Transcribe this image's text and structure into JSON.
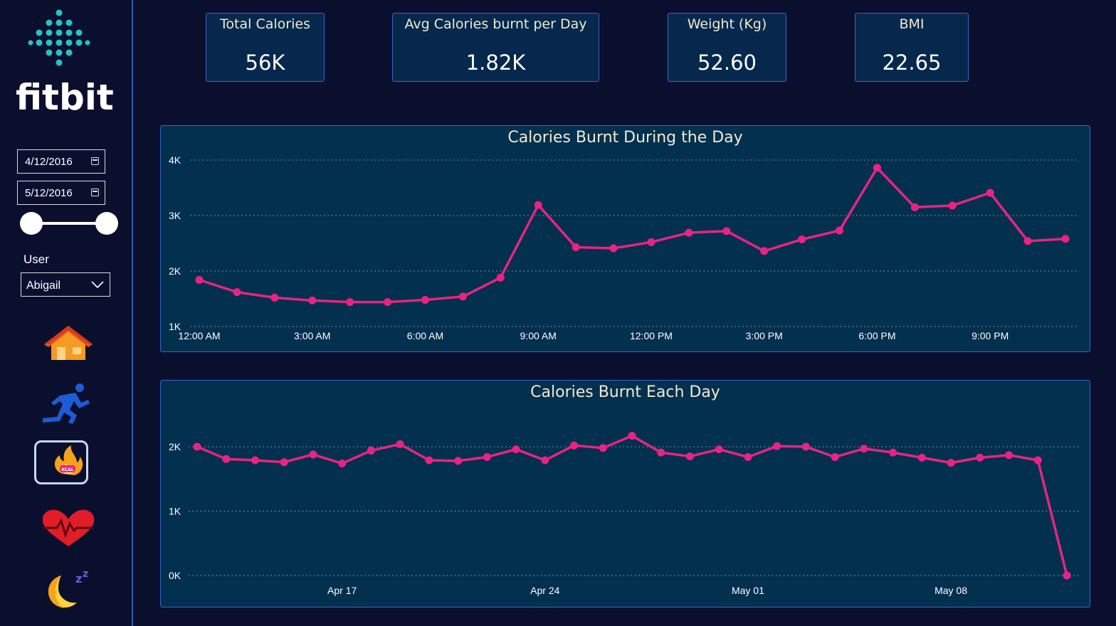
{
  "sidebar": {
    "brand": "fitbit",
    "date_start": "4/12/2016",
    "date_end": "5/12/2016",
    "user_label": "User",
    "user_value": "Abigail",
    "nav_items": [
      "home-icon",
      "running-icon",
      "calories-icon",
      "heart-rate-icon",
      "sleep-icon"
    ],
    "calories_badge": "KCAL"
  },
  "kpis": [
    {
      "title": "Total Calories",
      "value": "56K"
    },
    {
      "title": "Avg Calories burnt per Day",
      "value": "1.82K"
    },
    {
      "title": "Weight (Kg)",
      "value": "52.60"
    },
    {
      "title": "BMI",
      "value": "22.65"
    }
  ],
  "colors": {
    "background": "#0b0f2e",
    "panel": "#03304f",
    "border": "#3a63c8",
    "series": "#e8247f",
    "title_text": "#f0ead0"
  },
  "chart_data": [
    {
      "type": "line",
      "title": "Calories Burnt During the Day",
      "x": [
        "12:00 AM",
        "1:00 AM",
        "2:00 AM",
        "3:00 AM",
        "4:00 AM",
        "5:00 AM",
        "6:00 AM",
        "7:00 AM",
        "8:00 AM",
        "9:00 AM",
        "10:00 AM",
        "11:00 AM",
        "12:00 PM",
        "1:00 PM",
        "2:00 PM",
        "3:00 PM",
        "4:00 PM",
        "5:00 PM",
        "6:00 PM",
        "7:00 PM",
        "8:00 PM",
        "9:00 PM",
        "10:00 PM",
        "11:00 PM"
      ],
      "x_tick_labels": [
        "12:00 AM",
        "3:00 AM",
        "6:00 AM",
        "9:00 AM",
        "12:00 PM",
        "3:00 PM",
        "6:00 PM",
        "9:00 PM"
      ],
      "values": [
        1840,
        1620,
        1520,
        1470,
        1440,
        1440,
        1480,
        1540,
        1880,
        3190,
        2430,
        2410,
        2520,
        2690,
        2720,
        2360,
        2570,
        2730,
        3860,
        3150,
        3180,
        3410,
        2540,
        2580
      ],
      "ylim": [
        1000,
        4000
      ],
      "y_ticks": [
        "1K",
        "2K",
        "3K",
        "4K"
      ],
      "grid": true
    },
    {
      "type": "line",
      "title": "Calories Burnt Each Day",
      "x": [
        "Apr 12",
        "Apr 13",
        "Apr 14",
        "Apr 15",
        "Apr 16",
        "Apr 17",
        "Apr 18",
        "Apr 19",
        "Apr 20",
        "Apr 21",
        "Apr 22",
        "Apr 23",
        "Apr 24",
        "Apr 25",
        "Apr 26",
        "Apr 27",
        "Apr 28",
        "Apr 29",
        "Apr 30",
        "May 01",
        "May 02",
        "May 03",
        "May 04",
        "May 05",
        "May 06",
        "May 07",
        "May 08",
        "May 09",
        "May 10",
        "May 11",
        "May 12"
      ],
      "x_tick_labels": [
        "Apr 17",
        "Apr 24",
        "May 01",
        "May 08"
      ],
      "values": [
        2000,
        1810,
        1790,
        1760,
        1880,
        1740,
        1940,
        2040,
        1790,
        1780,
        1840,
        1960,
        1790,
        2020,
        1980,
        2170,
        1910,
        1850,
        1960,
        1840,
        2010,
        2000,
        1840,
        1970,
        1910,
        1830,
        1750,
        1830,
        1870,
        1790,
        0
      ],
      "ylim": [
        0,
        2000
      ],
      "y_ticks": [
        "0K",
        "1K",
        "2K"
      ],
      "grid": true
    }
  ]
}
